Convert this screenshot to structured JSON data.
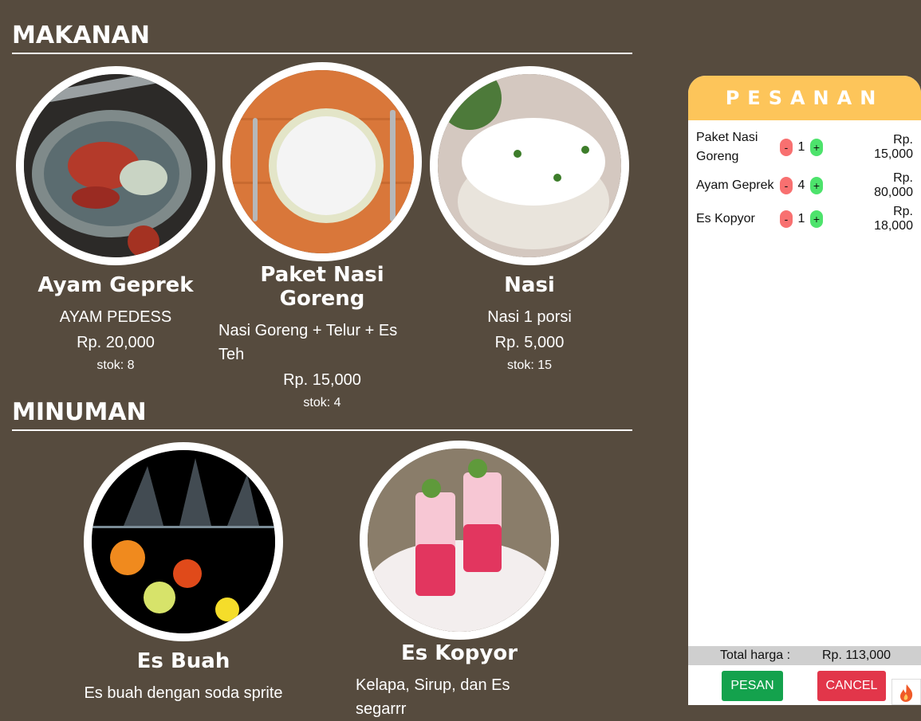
{
  "sections": {
    "makanan": "MAKANAN",
    "minuman": "MINUMAN"
  },
  "food": [
    {
      "name": "Ayam Geprek",
      "desc": "AYAM PEDESS",
      "price": "Rp. 20,000",
      "stock": "stok: 8"
    },
    {
      "name": "Paket Nasi Goreng",
      "desc": "Nasi Goreng + Telur + Es Teh",
      "price": "Rp. 15,000",
      "stock": "stok: 4"
    },
    {
      "name": "Nasi",
      "desc": "Nasi 1 porsi",
      "price": "Rp. 5,000",
      "stock": "stok: 15"
    }
  ],
  "drinks": [
    {
      "name": "Es Buah",
      "desc": "Es buah dengan soda sprite"
    },
    {
      "name": "Es Kopyor",
      "desc": "Kelapa, Sirup, dan Es segarrr"
    }
  ],
  "order": {
    "title": "PESANAN",
    "minus": "-",
    "plus": "+",
    "items": [
      {
        "name": "Paket Nasi Goreng",
        "qty": "1",
        "price": "Rp. 15,000"
      },
      {
        "name": "Ayam Geprek",
        "qty": "4",
        "price": "Rp. 80,000"
      },
      {
        "name": "Es Kopyor",
        "qty": "1",
        "price": "Rp. 18,000"
      }
    ],
    "total_label": "Total harga :",
    "total_value": "Rp. 113,000",
    "pesan_label": "PESAN",
    "cancel_label": "CANCEL"
  },
  "icons": {
    "fire": "fire-icon"
  },
  "colors": {
    "background": "#564b3e",
    "panel_header": "#fdc55a",
    "minus": "#f87070",
    "plus": "#4de36c",
    "pesan": "#14a24d",
    "cancel": "#e2364a"
  }
}
